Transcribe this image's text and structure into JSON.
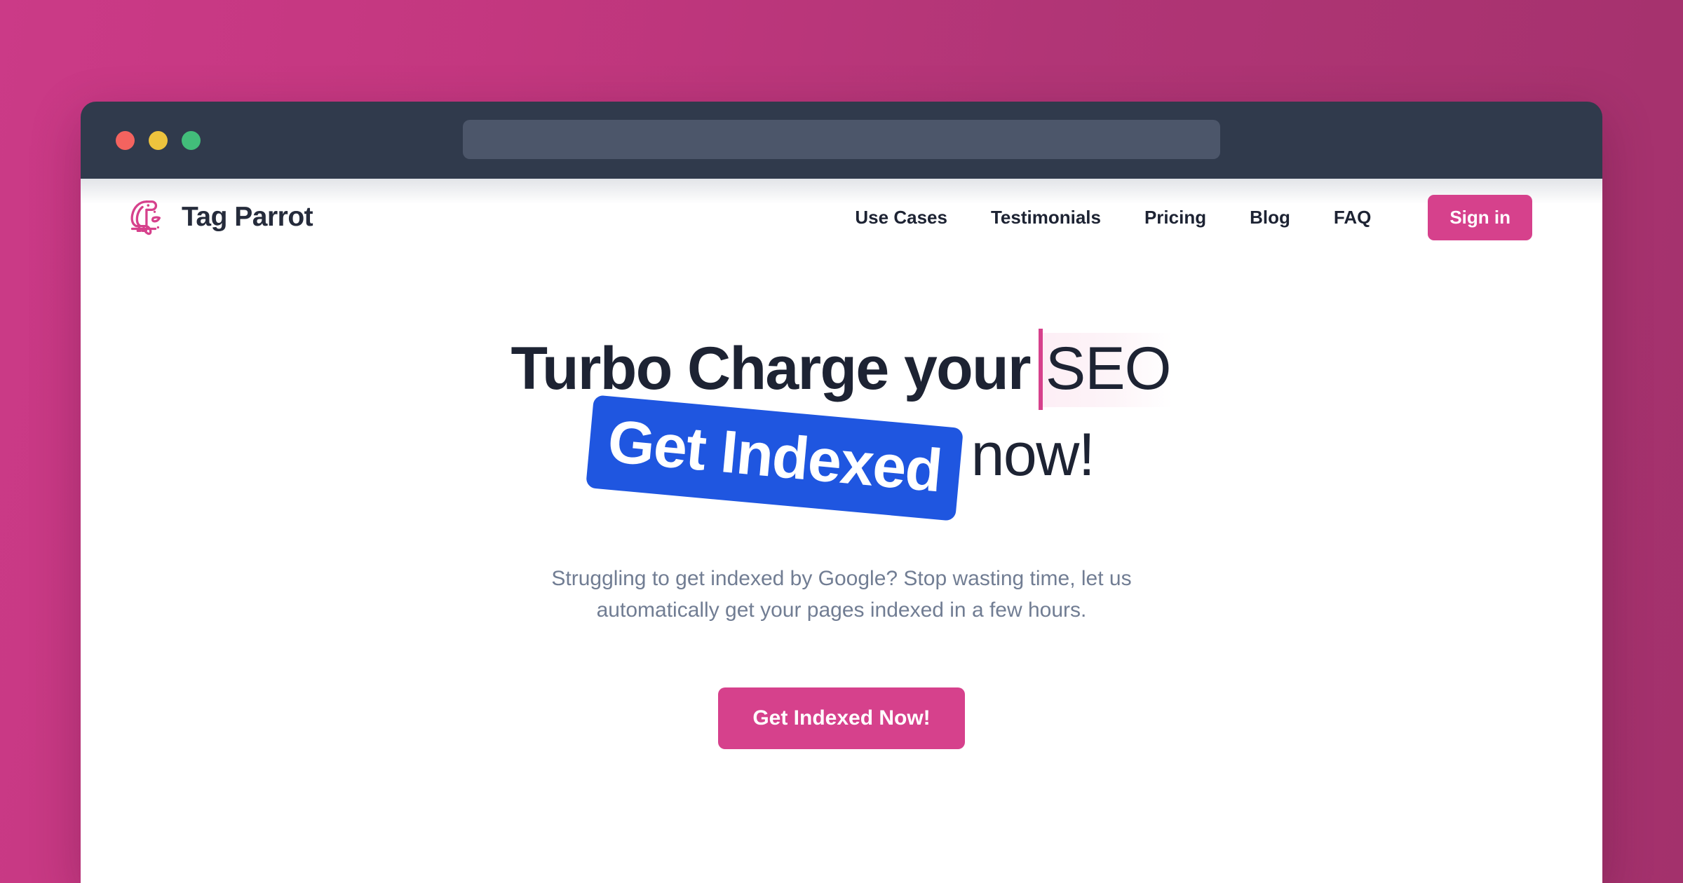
{
  "theme": {
    "page_gradient_from": "#cb3a87",
    "page_gradient_to": "#a3316c",
    "brand_pink": "#d6418c",
    "badge_blue": "#1f56e0",
    "titlebar_dark": "#303a4c",
    "text_dark": "#1d2333",
    "text_muted": "#717d93"
  },
  "browser": {
    "traffic_lights": [
      {
        "name": "close",
        "color": "#f4635f"
      },
      {
        "name": "minimize",
        "color": "#edc33d"
      },
      {
        "name": "maximize",
        "color": "#42bd7a"
      }
    ],
    "address_bar": {
      "value": "",
      "placeholder": ""
    }
  },
  "header": {
    "logo_icon": "parrot-icon",
    "brand_name": "Tag Parrot",
    "nav": [
      {
        "label": "Use Cases"
      },
      {
        "label": "Testimonials"
      },
      {
        "label": "Pricing"
      },
      {
        "label": "Blog"
      },
      {
        "label": "FAQ"
      }
    ],
    "signin_label": "Sign in"
  },
  "hero": {
    "headline_line1_static": "Turbo Charge your",
    "headline_line1_typed": "SEO",
    "headline_badge": "Get Indexed",
    "headline_line2_tail": "now!",
    "subtitle": "Struggling to get indexed by Google? Stop wasting time, let us automatically get your pages indexed in a few hours.",
    "cta_label": "Get Indexed Now!"
  }
}
